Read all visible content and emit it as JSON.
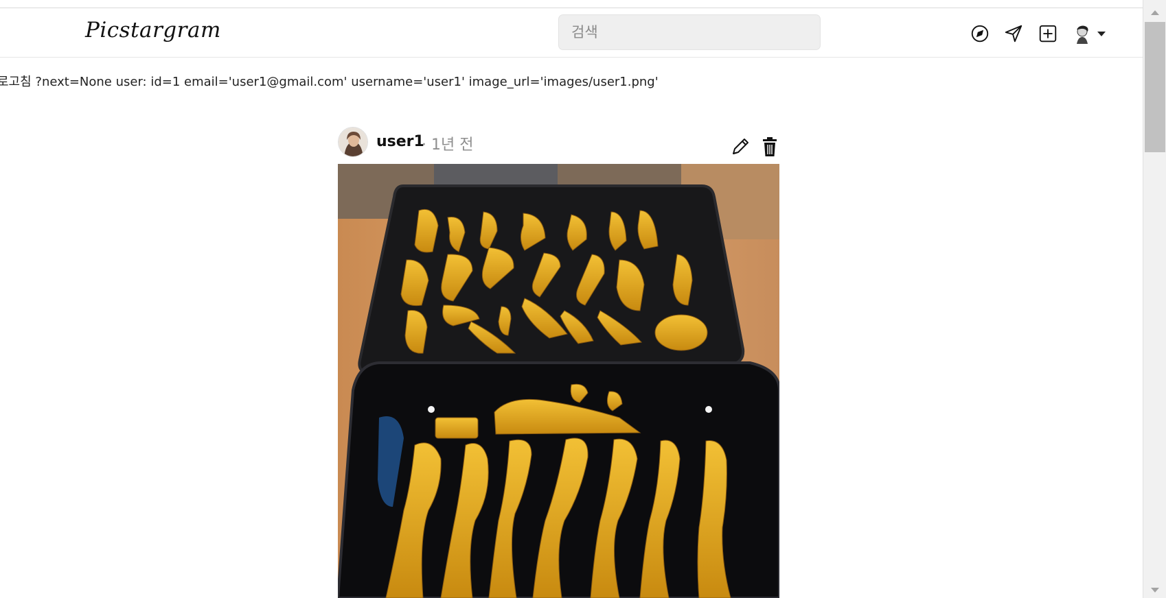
{
  "navbar": {
    "logo": "Picstargram",
    "search_placeholder": "검색",
    "icons": [
      "explore-icon",
      "send-icon",
      "add-post-icon"
    ],
    "profile_caret": "chevron-down-icon"
  },
  "debug_line": "로고침 ?next=None user: id=1 email='user1@gmail.com' username='user1' image_url='images/user1.png'",
  "post": {
    "username": "user1",
    "time": "· 1년 전",
    "actions": [
      "edit-icon",
      "delete-icon"
    ]
  },
  "colors": {
    "accent": "#111111",
    "muted": "#8e8e8e",
    "search_bg": "#efefef"
  }
}
